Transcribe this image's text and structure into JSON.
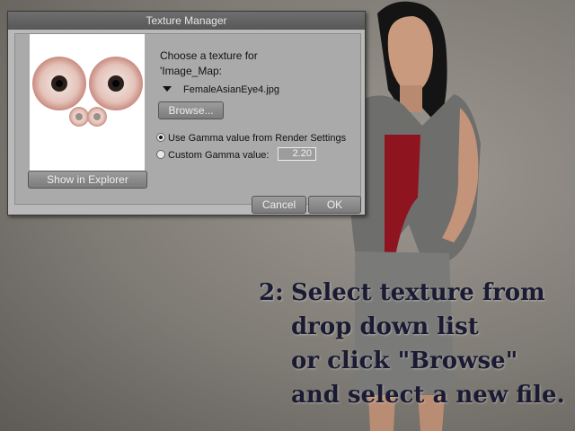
{
  "window": {
    "title": "Texture Manager"
  },
  "dialog": {
    "choose_text": "Choose a texture for",
    "map_name": "'Image_Map:",
    "dropdown": {
      "selected": "FemaleAsianEye4.jpg"
    },
    "browse_label": "Browse...",
    "radio_options": [
      {
        "label": "Use Gamma value from Render Settings",
        "checked": true
      },
      {
        "label": "Custom Gamma value:",
        "checked": false
      }
    ],
    "gamma_value": "2.20",
    "show_in_explorer_label": "Show in Explorer",
    "cancel_label": "Cancel",
    "ok_label": "OK"
  },
  "caption": {
    "step": "2:",
    "lines": [
      "Select texture from",
      "drop down list",
      "or click \"Browse\"",
      "and select a new file."
    ]
  },
  "colors": {
    "dialog_bg": "#b9b9b9",
    "titlebar": "#616161",
    "caption": "#1a1a33",
    "skirt": "#7a7a79",
    "top": "#8e1420"
  }
}
